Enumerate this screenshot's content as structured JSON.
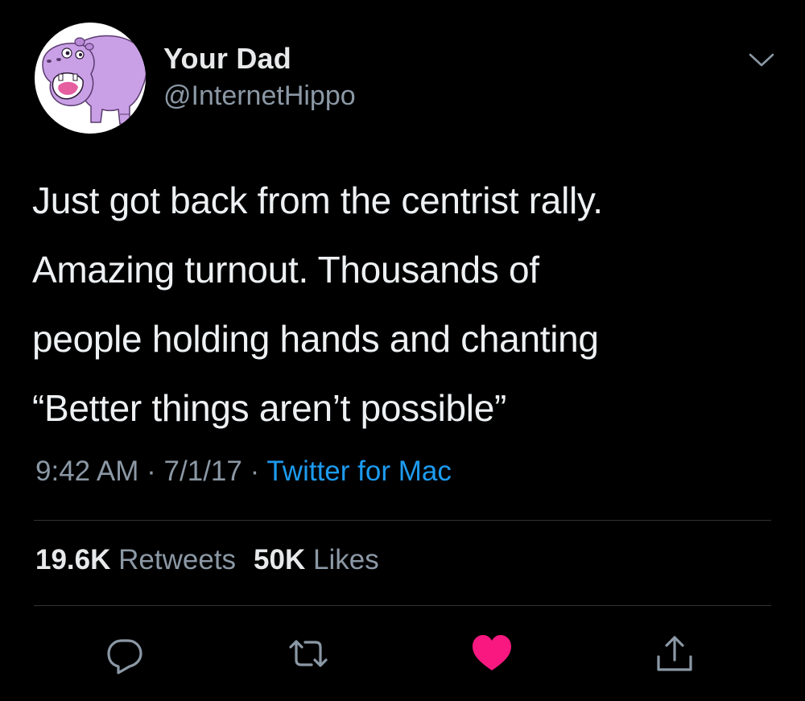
{
  "author": {
    "display_name": "Your Dad",
    "handle": "@InternetHippo",
    "avatar_icon": "hippo-avatar"
  },
  "tweet": {
    "lines": [
      "Just got back from the centrist rally.",
      "Amazing turnout. Thousands of",
      "people holding hands and chanting",
      "“Better things aren’t possible”"
    ],
    "time": "9:42 AM",
    "separator": "·",
    "date": "7/1/17",
    "source": "Twitter for Mac"
  },
  "stats": {
    "retweets_count": "19.6K",
    "retweets_label": "Retweets",
    "likes_count": "50K",
    "likes_label": "Likes"
  },
  "actions": [
    {
      "icon": "reply-icon"
    },
    {
      "icon": "retweet-icon"
    },
    {
      "icon": "heart-icon",
      "active": true
    },
    {
      "icon": "share-icon"
    }
  ],
  "colors": {
    "background": "#000000",
    "text_primary": "#e7e9ea",
    "text_secondary": "#8b98a5",
    "link": "#1d9bf0",
    "like_active": "#f91880",
    "avatar_hippo": "#c9a0e6"
  }
}
